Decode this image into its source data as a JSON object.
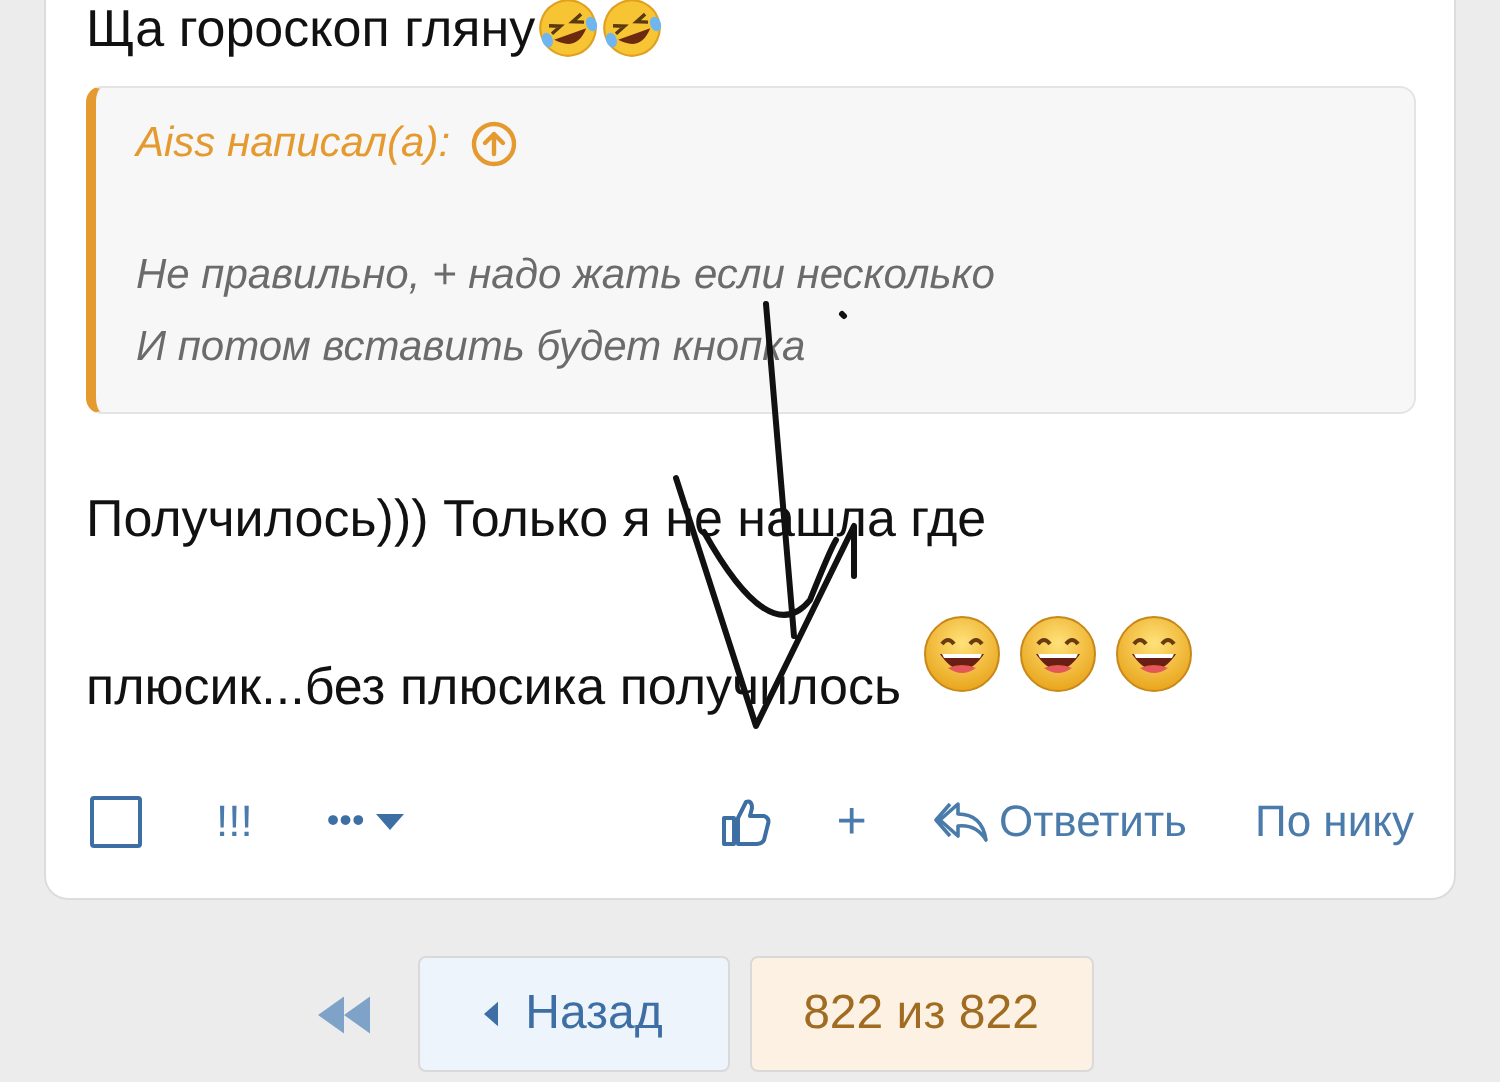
{
  "post": {
    "intro": "Ща гороскоп гляну",
    "quote": {
      "author": "Aiss написал(а):",
      "lines": [
        "Не правильно, + надо жать если несколько",
        "И потом вставить будет кнопка"
      ]
    },
    "paragraph": [
      "Получилось))) Только я не нашла где",
      "плюсик...без плюсика получилось"
    ],
    "actions": {
      "select": {
        "checked": false
      },
      "report": "!!!",
      "more": "•••",
      "plus": "+",
      "reply": "Ответить",
      "by_nick": "По нику"
    }
  },
  "pagination": {
    "back": "Назад",
    "page": "822 из 822"
  }
}
